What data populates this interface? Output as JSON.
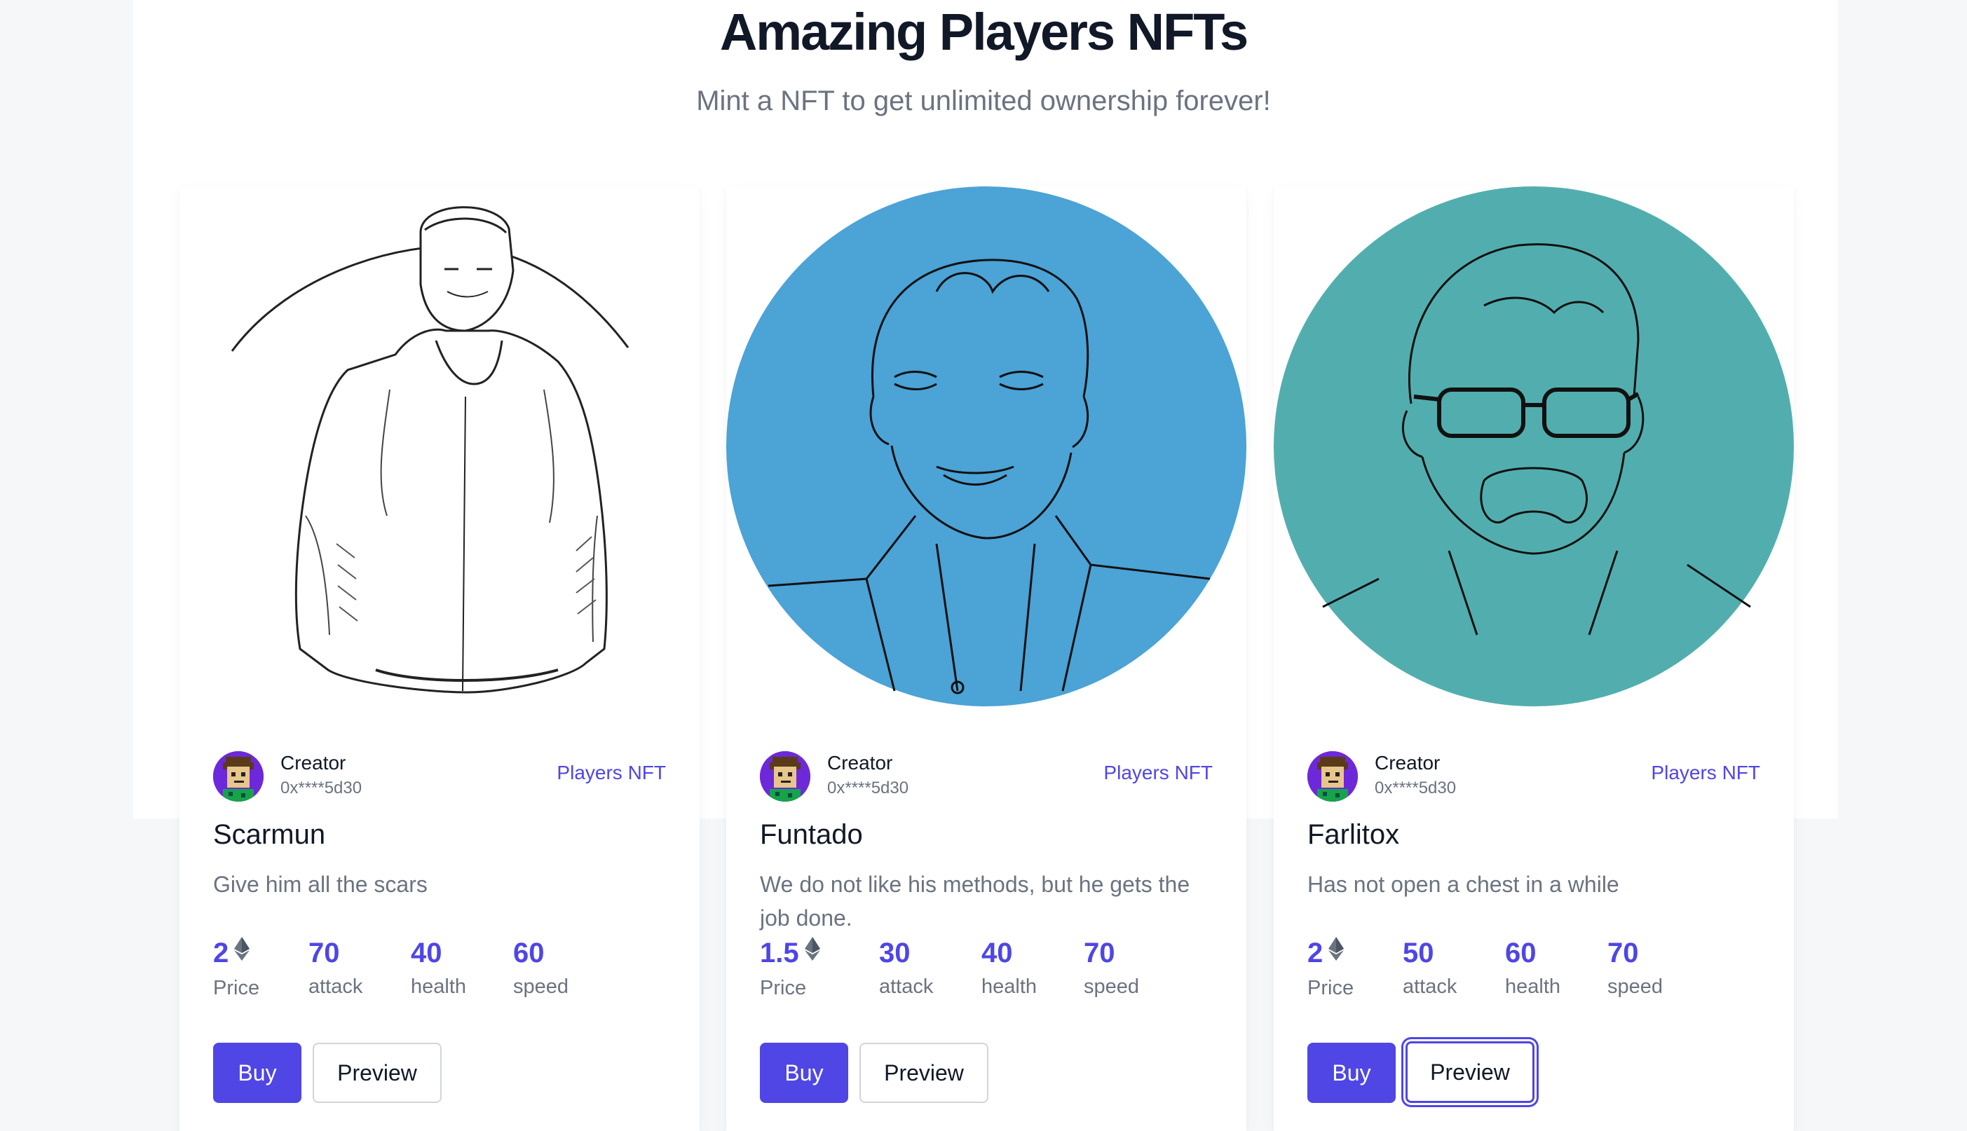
{
  "header": {
    "title": "Amazing Players NFTs",
    "subtitle": "Mint a NFT to get unlimited ownership forever!"
  },
  "colors": {
    "accent": "#4f46e5",
    "card2_bg": "#4ba3d6",
    "card3_bg": "#52aeae"
  },
  "cards": [
    {
      "name": "Scarmun",
      "description": "Give him all the scars",
      "creator_label": "Creator",
      "creator_address": "0x****5d30",
      "collection": "Players NFT",
      "price": "2",
      "price_label": "Price",
      "attack": "70",
      "attack_label": "attack",
      "health": "40",
      "health_label": "health",
      "speed": "60",
      "speed_label": "speed",
      "buy_label": "Buy",
      "preview_label": "Preview"
    },
    {
      "name": "Funtado",
      "description": "We do not like his methods, but he gets the job done.",
      "creator_label": "Creator",
      "creator_address": "0x****5d30",
      "collection": "Players NFT",
      "price": "1.5",
      "price_label": "Price",
      "attack": "30",
      "attack_label": "attack",
      "health": "40",
      "health_label": "health",
      "speed": "70",
      "speed_label": "speed",
      "buy_label": "Buy",
      "preview_label": "Preview"
    },
    {
      "name": "Farlitox",
      "description": "Has not open a chest in a while",
      "creator_label": "Creator",
      "creator_address": "0x****5d30",
      "collection": "Players NFT",
      "price": "2",
      "price_label": "Price",
      "attack": "50",
      "attack_label": "attack",
      "health": "60",
      "health_label": "health",
      "speed": "70",
      "speed_label": "speed",
      "buy_label": "Buy",
      "preview_label": "Preview"
    }
  ]
}
